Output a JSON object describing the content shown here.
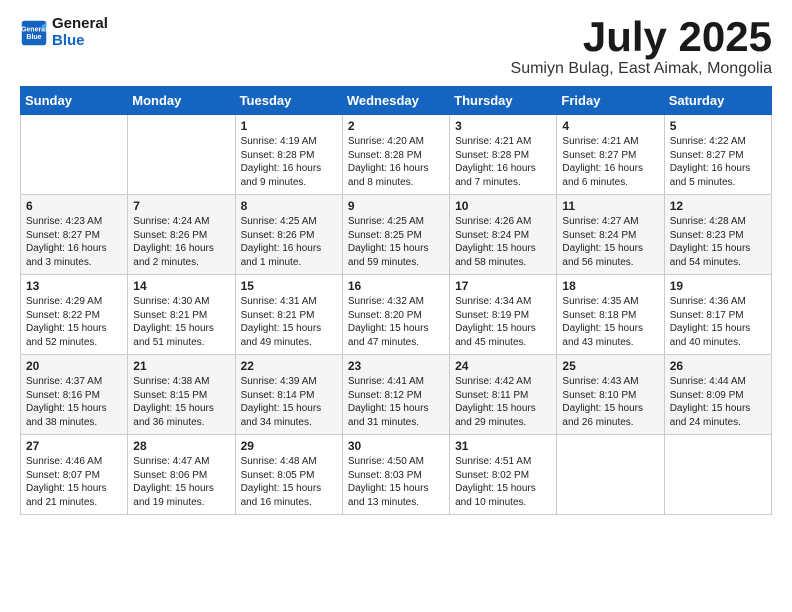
{
  "header": {
    "logo_line1": "General",
    "logo_line2": "Blue",
    "month_title": "July 2025",
    "location": "Sumiyn Bulag, East Aimak, Mongolia"
  },
  "days_of_week": [
    "Sunday",
    "Monday",
    "Tuesday",
    "Wednesday",
    "Thursday",
    "Friday",
    "Saturday"
  ],
  "weeks": [
    [
      {
        "day": "",
        "text": ""
      },
      {
        "day": "",
        "text": ""
      },
      {
        "day": "1",
        "text": "Sunrise: 4:19 AM\nSunset: 8:28 PM\nDaylight: 16 hours and 9 minutes."
      },
      {
        "day": "2",
        "text": "Sunrise: 4:20 AM\nSunset: 8:28 PM\nDaylight: 16 hours and 8 minutes."
      },
      {
        "day": "3",
        "text": "Sunrise: 4:21 AM\nSunset: 8:28 PM\nDaylight: 16 hours and 7 minutes."
      },
      {
        "day": "4",
        "text": "Sunrise: 4:21 AM\nSunset: 8:27 PM\nDaylight: 16 hours and 6 minutes."
      },
      {
        "day": "5",
        "text": "Sunrise: 4:22 AM\nSunset: 8:27 PM\nDaylight: 16 hours and 5 minutes."
      }
    ],
    [
      {
        "day": "6",
        "text": "Sunrise: 4:23 AM\nSunset: 8:27 PM\nDaylight: 16 hours and 3 minutes."
      },
      {
        "day": "7",
        "text": "Sunrise: 4:24 AM\nSunset: 8:26 PM\nDaylight: 16 hours and 2 minutes."
      },
      {
        "day": "8",
        "text": "Sunrise: 4:25 AM\nSunset: 8:26 PM\nDaylight: 16 hours and 1 minute."
      },
      {
        "day": "9",
        "text": "Sunrise: 4:25 AM\nSunset: 8:25 PM\nDaylight: 15 hours and 59 minutes."
      },
      {
        "day": "10",
        "text": "Sunrise: 4:26 AM\nSunset: 8:24 PM\nDaylight: 15 hours and 58 minutes."
      },
      {
        "day": "11",
        "text": "Sunrise: 4:27 AM\nSunset: 8:24 PM\nDaylight: 15 hours and 56 minutes."
      },
      {
        "day": "12",
        "text": "Sunrise: 4:28 AM\nSunset: 8:23 PM\nDaylight: 15 hours and 54 minutes."
      }
    ],
    [
      {
        "day": "13",
        "text": "Sunrise: 4:29 AM\nSunset: 8:22 PM\nDaylight: 15 hours and 52 minutes."
      },
      {
        "day": "14",
        "text": "Sunrise: 4:30 AM\nSunset: 8:21 PM\nDaylight: 15 hours and 51 minutes."
      },
      {
        "day": "15",
        "text": "Sunrise: 4:31 AM\nSunset: 8:21 PM\nDaylight: 15 hours and 49 minutes."
      },
      {
        "day": "16",
        "text": "Sunrise: 4:32 AM\nSunset: 8:20 PM\nDaylight: 15 hours and 47 minutes."
      },
      {
        "day": "17",
        "text": "Sunrise: 4:34 AM\nSunset: 8:19 PM\nDaylight: 15 hours and 45 minutes."
      },
      {
        "day": "18",
        "text": "Sunrise: 4:35 AM\nSunset: 8:18 PM\nDaylight: 15 hours and 43 minutes."
      },
      {
        "day": "19",
        "text": "Sunrise: 4:36 AM\nSunset: 8:17 PM\nDaylight: 15 hours and 40 minutes."
      }
    ],
    [
      {
        "day": "20",
        "text": "Sunrise: 4:37 AM\nSunset: 8:16 PM\nDaylight: 15 hours and 38 minutes."
      },
      {
        "day": "21",
        "text": "Sunrise: 4:38 AM\nSunset: 8:15 PM\nDaylight: 15 hours and 36 minutes."
      },
      {
        "day": "22",
        "text": "Sunrise: 4:39 AM\nSunset: 8:14 PM\nDaylight: 15 hours and 34 minutes."
      },
      {
        "day": "23",
        "text": "Sunrise: 4:41 AM\nSunset: 8:12 PM\nDaylight: 15 hours and 31 minutes."
      },
      {
        "day": "24",
        "text": "Sunrise: 4:42 AM\nSunset: 8:11 PM\nDaylight: 15 hours and 29 minutes."
      },
      {
        "day": "25",
        "text": "Sunrise: 4:43 AM\nSunset: 8:10 PM\nDaylight: 15 hours and 26 minutes."
      },
      {
        "day": "26",
        "text": "Sunrise: 4:44 AM\nSunset: 8:09 PM\nDaylight: 15 hours and 24 minutes."
      }
    ],
    [
      {
        "day": "27",
        "text": "Sunrise: 4:46 AM\nSunset: 8:07 PM\nDaylight: 15 hours and 21 minutes."
      },
      {
        "day": "28",
        "text": "Sunrise: 4:47 AM\nSunset: 8:06 PM\nDaylight: 15 hours and 19 minutes."
      },
      {
        "day": "29",
        "text": "Sunrise: 4:48 AM\nSunset: 8:05 PM\nDaylight: 15 hours and 16 minutes."
      },
      {
        "day": "30",
        "text": "Sunrise: 4:50 AM\nSunset: 8:03 PM\nDaylight: 15 hours and 13 minutes."
      },
      {
        "day": "31",
        "text": "Sunrise: 4:51 AM\nSunset: 8:02 PM\nDaylight: 15 hours and 10 minutes."
      },
      {
        "day": "",
        "text": ""
      },
      {
        "day": "",
        "text": ""
      }
    ]
  ]
}
